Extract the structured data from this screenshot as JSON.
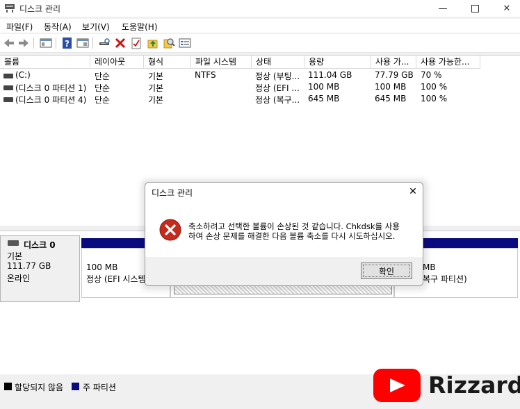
{
  "window": {
    "title": "디스크 관리"
  },
  "menu": [
    "파일(F)",
    "동작(A)",
    "보기(V)",
    "도움말(H)"
  ],
  "toolbar_icons": [
    "back-arrow-icon",
    "forward-arrow-icon",
    "console-tree-icon",
    "help-icon",
    "details-pane-icon",
    "connect-icon",
    "delete-icon",
    "properties-icon",
    "up-folder-icon",
    "search-icon",
    "export-list-icon"
  ],
  "volume_table": {
    "columns": [
      "볼륨",
      "레이아웃",
      "형식",
      "파일 시스템",
      "상태",
      "용량",
      "사용 가...",
      "사용 가능한..."
    ],
    "rows": [
      [
        "(C:)",
        "단순",
        "기본",
        "NTFS",
        "정상 (부팅...",
        "111.04 GB",
        "77.79 GB",
        "70 %"
      ],
      [
        "(디스크 0 파티션 1)",
        "단순",
        "기본",
        "",
        "정상 (EFI ...",
        "100 MB",
        "100 MB",
        "100 %"
      ],
      [
        "(디스크 0 파티션 4)",
        "단순",
        "기본",
        "",
        "정상 (복구...",
        "645 MB",
        "645 MB",
        "100 %"
      ]
    ]
  },
  "disk": {
    "name": "디스크 0",
    "type": "기본",
    "size": "111.77 GB",
    "status": "온라인",
    "partitions": [
      {
        "size": "100 MB",
        "status": "정상 (EFI 시스템"
      },
      {
        "size": "MB",
        "status": "복구 파티션)"
      }
    ]
  },
  "legend": {
    "unallocated": "할당되지 않음",
    "primary": "주 파티션",
    "unallocated_color": "#000000",
    "primary_color": "#0b0b80"
  },
  "dialog": {
    "title": "디스크 관리",
    "message_line1": "축소하려고 선택한 볼륨이 손상된 것 같습니다. Chkdsk를 사용",
    "message_line2": "하여 손상 문제를 해결한 다음 볼륨 축소를 다시 시도하십시오.",
    "ok_label": "확인",
    "icon": "error-icon"
  },
  "watermark": {
    "text": "Rizzardo",
    "icon": "youtube-logo-icon"
  }
}
